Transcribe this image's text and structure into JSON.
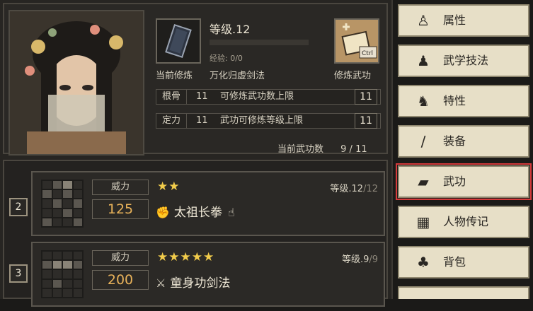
{
  "info": {
    "level_label": "等级.12",
    "exp_label": "经验: 0/0",
    "book_caption": "当前修炼",
    "book_skill_name": "万化归虚剑法",
    "practice_caption": "修炼武功",
    "ctrl_hint": "Ctrl",
    "stats": [
      {
        "key": "根骨",
        "num": "11",
        "desc": "可修炼武功数上限",
        "value": "11"
      },
      {
        "key": "定力",
        "num": "11",
        "desc": "武功可修炼等级上限",
        "value": "11"
      }
    ],
    "current_count_label": "当前武功数",
    "current_count_value": "9 / 11"
  },
  "skills": [
    {
      "index": "2",
      "power_label": "威力",
      "power": "125",
      "stars": "★★",
      "level": "等级.12",
      "level_max": "/12",
      "icon": "fist-icon",
      "icon_glyph": "✊",
      "name": "太祖长拳",
      "hand": "☝"
    },
    {
      "index": "3",
      "power_label": "威力",
      "power": "200",
      "stars": "★★★★★",
      "level": "等级.9",
      "level_max": "/9",
      "icon": "sword-icon",
      "icon_glyph": "⚔",
      "name": "童身功剑法",
      "hand": ""
    }
  ],
  "menu": [
    {
      "label": "属性",
      "icon": "person-icon",
      "glyph": "♙"
    },
    {
      "label": "武学技法",
      "icon": "martial-person-icon",
      "glyph": "♟"
    },
    {
      "label": "特性",
      "icon": "trait-icon",
      "glyph": "♞"
    },
    {
      "label": "装备",
      "icon": "sword-equip-icon",
      "glyph": "/"
    },
    {
      "label": "武功",
      "icon": "book-icon",
      "glyph": "▰",
      "selected": true
    },
    {
      "label": "人物传记",
      "icon": "scroll-icon",
      "glyph": "▦"
    },
    {
      "label": "背包",
      "icon": "bag-icon",
      "glyph": "♣"
    },
    {
      "label": "",
      "icon": "more-icon",
      "glyph": ""
    }
  ]
}
